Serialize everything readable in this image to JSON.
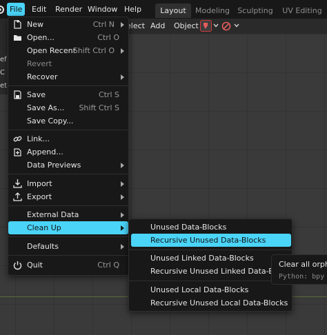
{
  "topbar": {
    "menus": [
      "File",
      "Edit",
      "Render",
      "Window",
      "Help"
    ],
    "workspace_tabs": [
      "Layout",
      "Modeling",
      "Sculpting",
      "UV Editing"
    ],
    "active_tab": "Layout"
  },
  "viewport_header": {
    "select_fragment": "elect",
    "add": "Add",
    "object": "Object"
  },
  "left_fragments": [
    "ef",
    "C",
    "et"
  ],
  "file_menu": {
    "items": [
      {
        "label": "New",
        "shortcut": "Ctrl N",
        "icon": "new-file-icon"
      },
      {
        "label": "Open...",
        "shortcut": "Ctrl O",
        "icon": "folder-icon"
      },
      {
        "label": "Open Recent",
        "shortcut": "Shift Ctrl O"
      },
      {
        "label": "Revert",
        "shortcut": ""
      },
      {
        "label": "Recover",
        "shortcut": ""
      },
      {
        "label": "Save",
        "shortcut": "Ctrl S",
        "icon": "save-icon"
      },
      {
        "label": "Save As...",
        "shortcut": "Shift Ctrl S"
      },
      {
        "label": "Save Copy...",
        "shortcut": ""
      },
      {
        "label": "Link...",
        "shortcut": "",
        "icon": "link-icon"
      },
      {
        "label": "Append...",
        "shortcut": "",
        "icon": "append-icon"
      },
      {
        "label": "Data Previews",
        "shortcut": ""
      },
      {
        "label": "Import",
        "shortcut": "",
        "icon": "import-icon"
      },
      {
        "label": "Export",
        "shortcut": "",
        "icon": "export-icon"
      },
      {
        "label": "External Data",
        "shortcut": ""
      },
      {
        "label": "Clean Up",
        "shortcut": ""
      },
      {
        "label": "Defaults",
        "shortcut": ""
      },
      {
        "label": "Quit",
        "shortcut": "Ctrl Q",
        "icon": "power-icon"
      }
    ]
  },
  "cleanup_submenu": {
    "items": [
      "Unused Data-Blocks",
      "Recursive Unused Data-Blocks",
      "Unused Linked Data-Blocks",
      "Recursive Unused Linked Data-Blocks",
      "Unused Local Data-Blocks",
      "Recursive Unused Local Data-Blocks"
    ]
  },
  "tooltip": {
    "description": "Clear all orpha",
    "python": "Python: bpy"
  },
  "colors": {
    "accent": "#4ad4f8",
    "menu_bg": "#181818",
    "viewport_bg": "#3a3a3a"
  }
}
